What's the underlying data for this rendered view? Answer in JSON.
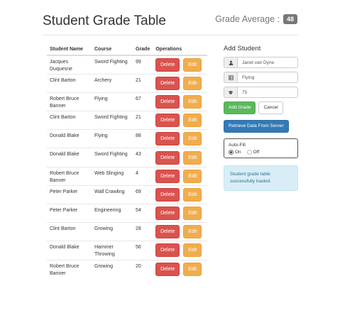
{
  "header": {
    "title": "Student Grade Table",
    "average_label": "Grade Average :",
    "average_value": "48"
  },
  "table": {
    "columns": [
      "Student Name",
      "Course",
      "Grade",
      "Operations"
    ],
    "delete_label": "Delete",
    "edit_label": "Edit",
    "rows": [
      {
        "name": "Jacques Duquesne",
        "course": "Sword Fighting",
        "grade": "99"
      },
      {
        "name": "Clint Barton",
        "course": "Archery",
        "grade": "21"
      },
      {
        "name": "Robert Bruce Banner",
        "course": "Flying",
        "grade": "67"
      },
      {
        "name": "Clint Barton",
        "course": "Sword Fighting",
        "grade": "21"
      },
      {
        "name": "Donald Blake",
        "course": "Flying",
        "grade": "88"
      },
      {
        "name": "Donald Blake",
        "course": "Sword Fighting",
        "grade": "43"
      },
      {
        "name": "Robert Bruce Banner",
        "course": "Web Slinging",
        "grade": "4"
      },
      {
        "name": "Peter Parker",
        "course": "Wall Crawling",
        "grade": "69"
      },
      {
        "name": "Peter Parker",
        "course": "Engineering",
        "grade": "54"
      },
      {
        "name": "Clint Barton",
        "course": "Growing",
        "grade": "28"
      },
      {
        "name": "Donald Blake",
        "course": "Hammer Throwing",
        "grade": "56"
      },
      {
        "name": "Robert Bruce Banner",
        "course": "Growing",
        "grade": "20"
      }
    ]
  },
  "form": {
    "title": "Add Student",
    "name_value": "Janet van Dyne",
    "course_value": "Flying",
    "grade_value": "75",
    "add_label": "Add Grade",
    "cancel_label": "Cancel",
    "retrieve_label": "Retrieve Data From Server",
    "autofill": {
      "label": "Auto-Fill",
      "on_label": "On",
      "off_label": "Off",
      "selected": "On"
    },
    "alert_text": "Student grade table successfully loaded."
  },
  "icons": {
    "name_field": "user-icon",
    "course_field": "list-icon",
    "grade_field": "graduation-cap-icon"
  },
  "colors": {
    "delete": "#d9534f",
    "edit": "#f0ad4e",
    "add": "#5cb85c",
    "retrieve": "#337ab7",
    "alert_bg": "#d9edf7",
    "badge": "#777777"
  }
}
